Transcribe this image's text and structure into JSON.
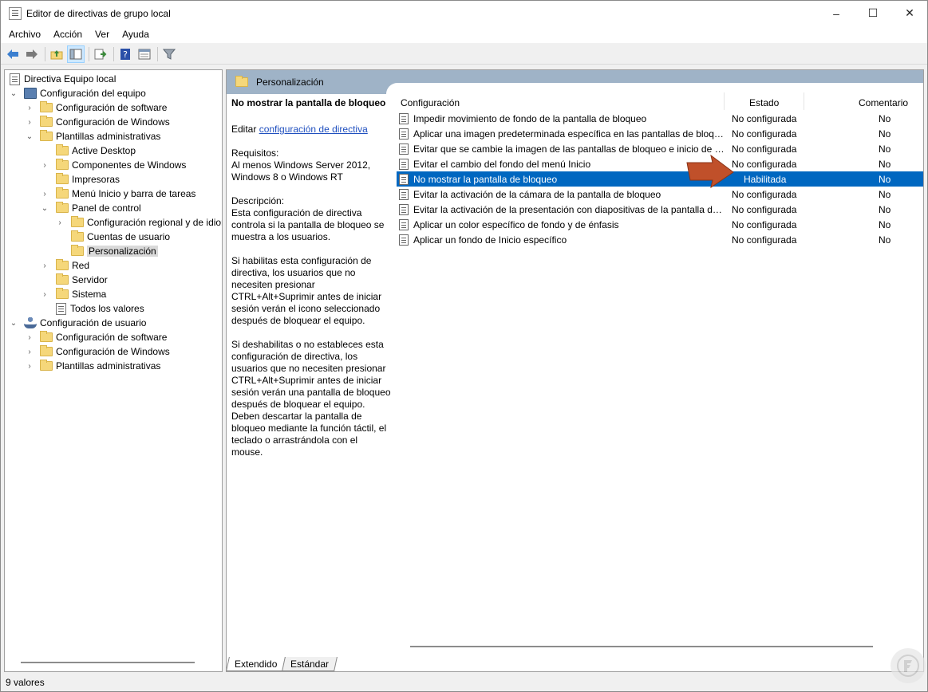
{
  "window": {
    "title": "Editor de directivas de grupo local"
  },
  "menu": [
    "Archivo",
    "Acción",
    "Ver",
    "Ayuda"
  ],
  "toolbar": {
    "icons": [
      "back-arrow-icon",
      "forward-arrow-icon",
      "up-folder-icon",
      "show-hide-tree-icon",
      "export-list-icon",
      "help-icon",
      "properties-icon",
      "filter-icon"
    ]
  },
  "tree": {
    "root": "Directiva Equipo local",
    "items": [
      {
        "label": "Configuración del equipo"
      },
      {
        "label": "Configuración de software"
      },
      {
        "label": "Configuración de Windows"
      },
      {
        "label": "Plantillas administrativas"
      },
      {
        "label": "Active Desktop"
      },
      {
        "label": "Componentes de Windows"
      },
      {
        "label": "Impresoras"
      },
      {
        "label": "Menú Inicio y barra de tareas"
      },
      {
        "label": "Panel de control"
      },
      {
        "label": "Configuración regional y de idioma"
      },
      {
        "label": "Cuentas de usuario"
      },
      {
        "label": "Personalización"
      },
      {
        "label": "Red"
      },
      {
        "label": "Servidor"
      },
      {
        "label": "Sistema"
      },
      {
        "label": "Todos los valores"
      },
      {
        "label": "Configuración de usuario"
      },
      {
        "label": "Configuración de software"
      },
      {
        "label": "Configuración de Windows"
      },
      {
        "label": "Plantillas administrativas"
      }
    ]
  },
  "details": {
    "header": "Personalización",
    "policy_title": "No mostrar la pantalla de bloqueo",
    "edit_prefix": "Editar ",
    "edit_link": "configuración de directiva",
    "requirements": "Requisitos:\nAl menos Windows Server 2012, Windows 8 o Windows RT",
    "description_label": "Descripción:",
    "description": "Esta configuración de directiva controla si la pantalla de bloqueo se muestra a los usuarios.",
    "desc_enabled": "Si habilitas esta configuración de directiva, los usuarios que no necesiten presionar CTRL+Alt+Suprimir antes de iniciar sesión verán el icono seleccionado después de bloquear el equipo.",
    "desc_disabled": "Si deshabilitas o no estableces esta configuración de directiva, los usuarios que no necesiten presionar CTRL+Alt+Suprimir antes de iniciar sesión verán una pantalla de bloqueo después de bloquear el equipo. Deben descartar la pantalla de bloqueo mediante la función táctil, el teclado o arrastrándola con el mouse."
  },
  "columns": {
    "config": "Configuración",
    "state": "Estado",
    "comment": "Comentario"
  },
  "rows": [
    {
      "name": "Impedir movimiento de fondo de la pantalla de bloqueo",
      "state": "No configurada",
      "comment": "No"
    },
    {
      "name": "Aplicar una imagen predeterminada específica en las pantallas de bloqueo e inicio de sesión",
      "state": "No configurada",
      "comment": "No"
    },
    {
      "name": "Evitar que se cambie la imagen de las pantallas de bloqueo e inicio de sesión",
      "state": "No configurada",
      "comment": "No"
    },
    {
      "name": "Evitar el cambio del fondo del menú Inicio",
      "state": "No configurada",
      "comment": "No"
    },
    {
      "name": "No mostrar la pantalla de bloqueo",
      "state": "Habilitada",
      "comment": "No"
    },
    {
      "name": "Evitar la activación de la cámara de la pantalla de bloqueo",
      "state": "No configurada",
      "comment": "No"
    },
    {
      "name": "Evitar la activación de la presentación con diapositivas de la pantalla de bloqueo",
      "state": "No configurada",
      "comment": "No"
    },
    {
      "name": "Aplicar un color específico de fondo y de énfasis",
      "state": "No configurada",
      "comment": "No"
    },
    {
      "name": "Aplicar un fondo de Inicio específico",
      "state": "No configurada",
      "comment": "No"
    }
  ],
  "tabs": [
    "Extendido",
    "Estándar"
  ],
  "status": "9 valores",
  "colors": {
    "selection": "#0067c0",
    "header": "#9fb3c7",
    "arrow": "#c0502a"
  }
}
